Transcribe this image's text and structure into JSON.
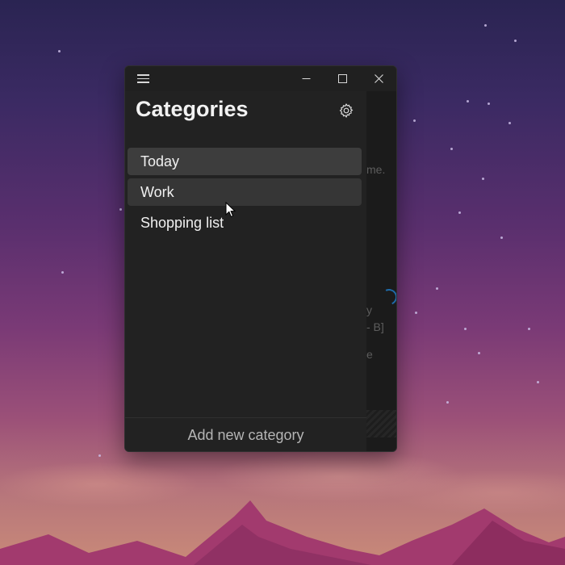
{
  "window": {
    "title_buttons": {
      "menu_icon": "hamburger-icon",
      "minimize_icon": "minimize-icon",
      "maximize_icon": "maximize-icon",
      "close_icon": "close-icon"
    }
  },
  "pane": {
    "title": "Categories",
    "settings_icon": "gear-icon",
    "categories": [
      {
        "label": "Today",
        "state": "selected"
      },
      {
        "label": "Work",
        "state": "hover"
      },
      {
        "label": "Shopping list",
        "state": "normal"
      }
    ],
    "add_category_label": "Add new category"
  },
  "background_window": {
    "fragments": [
      "me.",
      "y",
      "- B]",
      "e"
    ]
  },
  "colors": {
    "window_bg": "#202020",
    "pane_bg": "#222222",
    "selected_item_bg": "#3d3d3d",
    "hover_item_bg": "#363636",
    "text_primary": "#f2f2f2",
    "text_secondary": "#b5b5b5",
    "accent_ring": "#1f6aa8"
  }
}
